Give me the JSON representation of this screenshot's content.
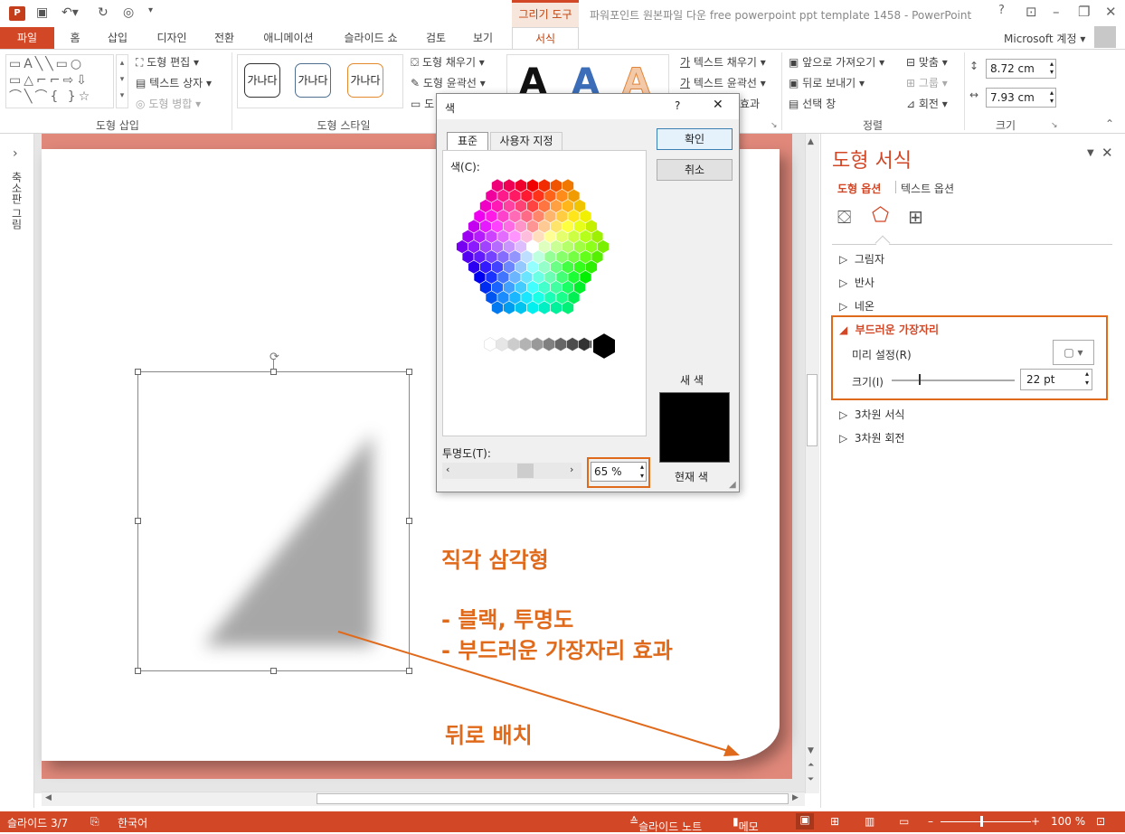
{
  "title_bar": {
    "app_icon": "P",
    "context_tab": "그리기 도구",
    "document_title": "파워포인트 원본파일 다운 free powerpoint ppt template 1458 - PowerPoint",
    "help": "?",
    "minimize": "–",
    "restore": "❐",
    "close": "✕"
  },
  "tabs": [
    "파일",
    "홈",
    "삽입",
    "디자인",
    "전환",
    "애니메이션",
    "슬라이드 쇼",
    "검토",
    "보기",
    "서식"
  ],
  "account": "Microsoft 계정",
  "ribbon": {
    "insert_shapes": {
      "label": "도형 삽입",
      "edit_shape": "도형 편집",
      "text_box": "텍스트 상자",
      "merge_shapes": "도형 병합",
      "shapes_glyphs": "▭A╲╲▭○\n▭△⌐⌐⇨⇩\n⌒╲⌒{ }☆"
    },
    "shape_styles": {
      "label": "도형 스타일",
      "sample": "가나다",
      "fill": "도형 채우기",
      "outline": "도형 윤곽선",
      "effects": "도"
    },
    "wordart": {
      "sample": "A",
      "text_fill": "텍스트 채우기",
      "text_outline": "텍스트 윤곽선",
      "text_effects": "효과"
    },
    "arrange": {
      "label": "정렬",
      "bring_forward": "앞으로 가져오기",
      "send_backward": "뒤로 보내기",
      "selection_pane": "선택 창",
      "align": "맞춤",
      "group": "그룹",
      "rotate": "회전"
    },
    "size": {
      "label": "크기",
      "height": "8.72 cm",
      "width": "7.93 cm"
    }
  },
  "left_nav": {
    "label": "축소판 그림",
    "expand": "›"
  },
  "slide": {
    "annotations": {
      "line1": "직각 삼각형",
      "line2": "- 블랙, 투명도",
      "line3": "- 부드러운 가장자리 효과",
      "line4": "뒤로 배치"
    }
  },
  "format_pane": {
    "title": "도형 서식",
    "tab_shape": "도형 옵션",
    "tab_text": "텍스트 옵션",
    "sections": [
      "그림자",
      "반사",
      "네온"
    ],
    "soft_edges": {
      "title": "부드러운 가장자리",
      "preset_label": "미리 설정(R)",
      "size_label": "크기(I)",
      "size_value": "22 pt"
    },
    "more_sections": [
      "3차원 서식",
      "3차원 회전"
    ]
  },
  "color_dialog": {
    "title": "색",
    "help": "?",
    "tab_standard": "표준",
    "tab_custom": "사용자 지정",
    "colors_label": "색(C):",
    "ok": "확인",
    "cancel": "취소",
    "new_label": "새 색",
    "current_label": "현재 색",
    "transparency_label": "투명도(T):",
    "transparency_value": "65 %"
  },
  "status_bar": {
    "slide": "슬라이드 3/7",
    "language": "한국어",
    "notes": "슬라이드 노트",
    "comments": "메모",
    "zoom": "100 %"
  },
  "colors": {
    "accent": "#d24726",
    "annotation": "#e06a1b",
    "slide_bg": "#e0887a"
  }
}
